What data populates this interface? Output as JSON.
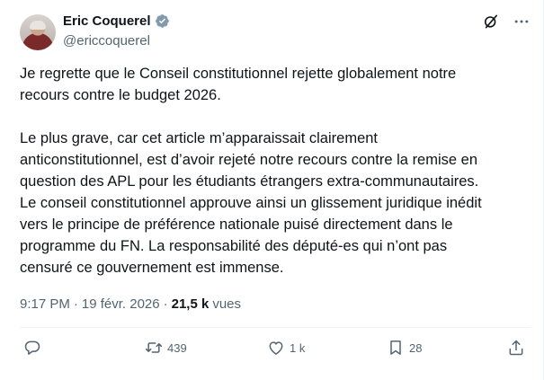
{
  "author": {
    "display_name": "Eric Coquerel",
    "handle": "@ericcoquerel"
  },
  "icons": {
    "verified": "verified-badge-icon",
    "grok": "grok-icon",
    "more": "more-options-icon",
    "reply": "reply-icon",
    "retweet": "retweet-icon",
    "like": "like-icon",
    "bookmark": "bookmark-icon",
    "share": "share-icon"
  },
  "colors": {
    "text": "#0f1419",
    "secondary": "#536471",
    "verified": "#829aab"
  },
  "tweet": {
    "text": "Je regrette que le Conseil constitutionnel rejette globalement notre\nrecours contre le budget 2026.\n\nLe plus grave, car cet article m’apparaissait clairement\nanticonstitutionnel, est d’avoir rejeté notre recours contre la remise en\nquestion  des APL pour les étudiants étrangers extra-communautaires.\nLe conseil constitutionnel approuve ainsi un glissement juridique inédit\nvers le principe de préférence nationale puisé directement dans le\nprogramme du FN. La responsabilité des député-es qui n’ont pas\ncensuré ce gouvernement est immense.",
    "time": "9:17 PM",
    "separator": "·",
    "date": "19 févr. 2026",
    "views_count": "21,5 k",
    "views_label": "vues"
  },
  "stats": {
    "replies": "",
    "retweets": "439",
    "likes": "1 k",
    "bookmarks": "28"
  }
}
